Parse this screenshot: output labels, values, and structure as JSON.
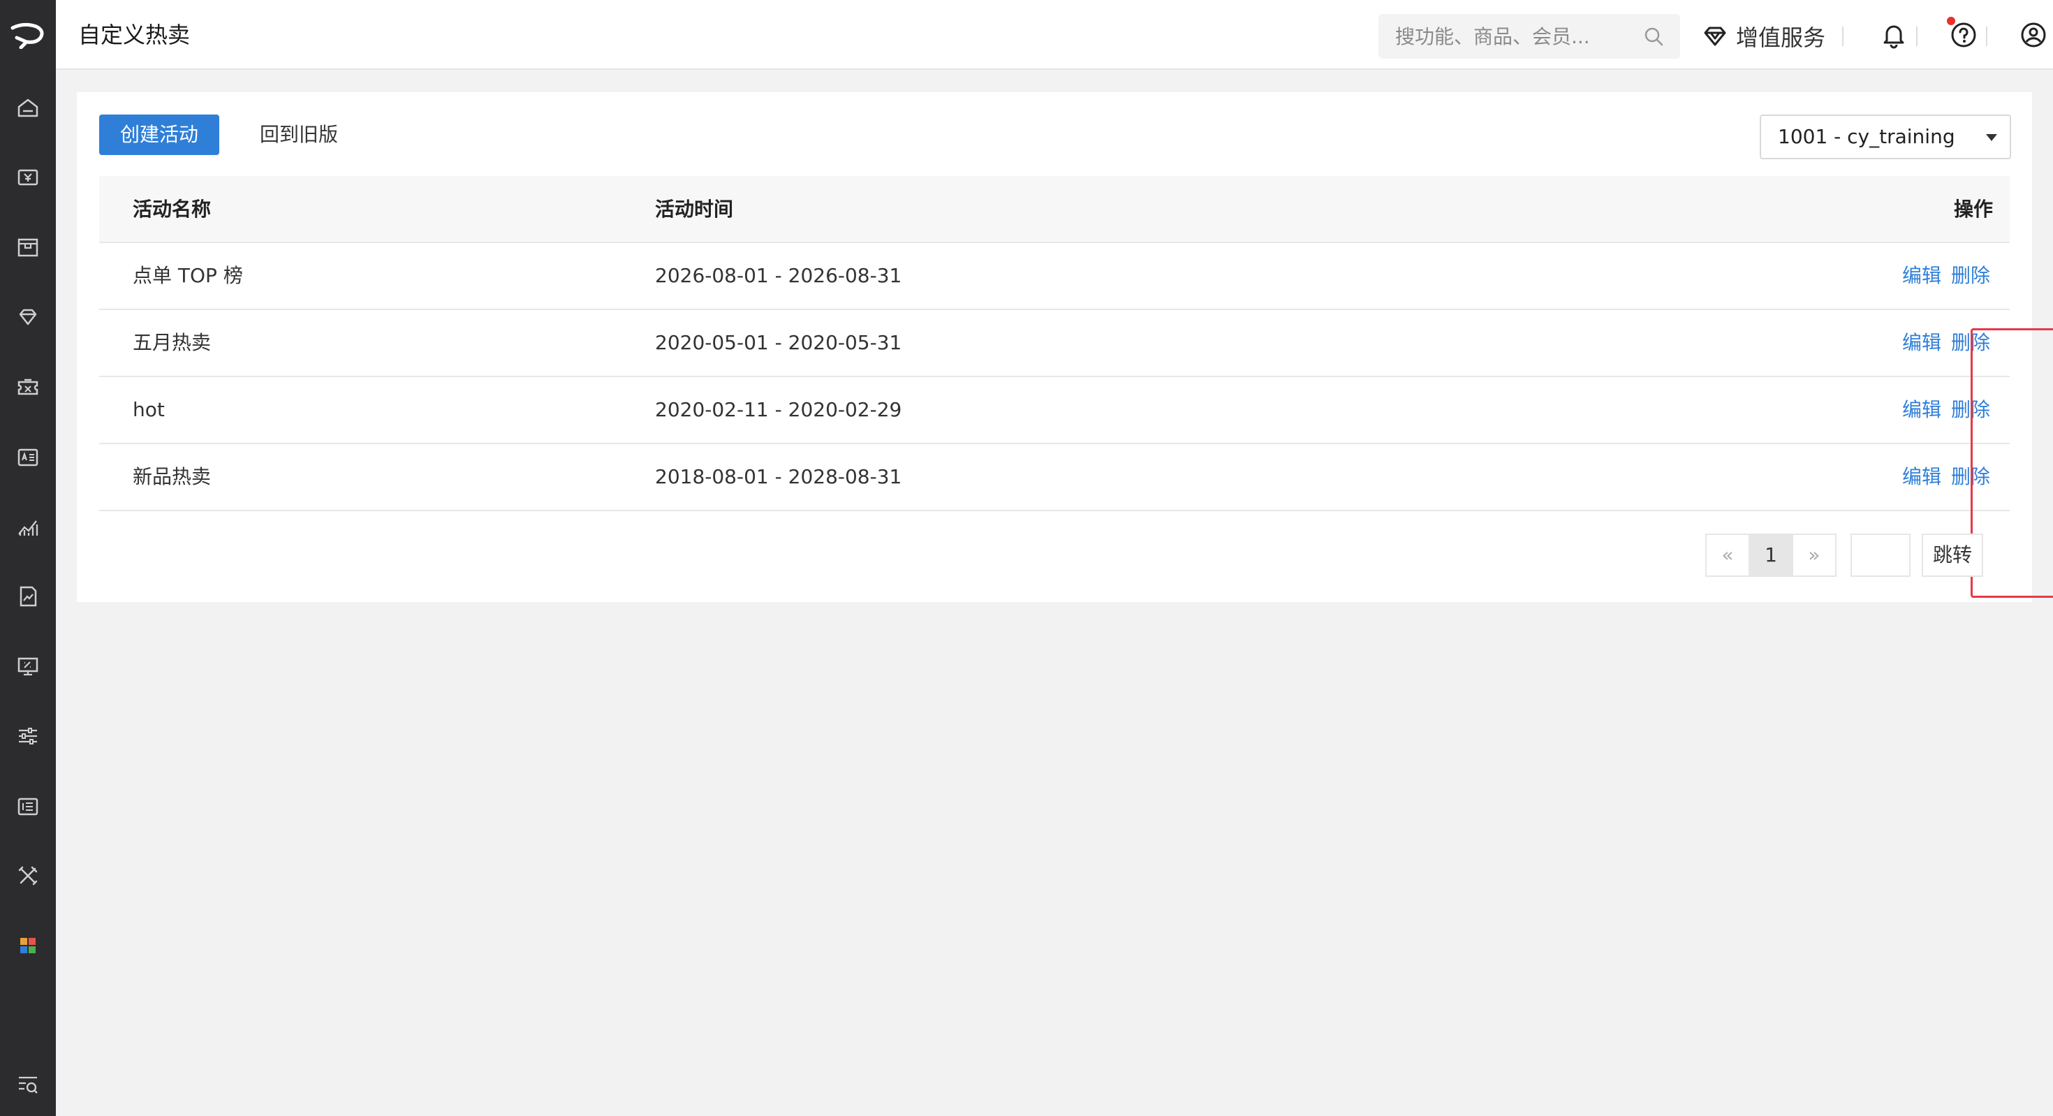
{
  "header": {
    "title": "自定义热卖",
    "search_placeholder": "搜功能、商品、会员...",
    "value_added_label": "增值服务"
  },
  "toolbar": {
    "create_label": "创建活动",
    "old_version_label": "回到旧版",
    "store_value": "1001 - cy_training"
  },
  "table": {
    "columns": [
      "活动名称",
      "活动时间",
      "操作"
    ],
    "rows": [
      {
        "name": "点单 TOP 榜",
        "time": "2026-08-01 - 2026-08-31",
        "edit": "编辑",
        "delete": "删除"
      },
      {
        "name": "五月热卖",
        "time": "2020-05-01 - 2020-05-31",
        "edit": "编辑",
        "delete": "删除"
      },
      {
        "name": "hot",
        "time": "2020-02-11 - 2020-02-29",
        "edit": "编辑",
        "delete": "删除"
      },
      {
        "name": "新品热卖",
        "time": "2018-08-01 - 2028-08-31",
        "edit": "编辑",
        "delete": "删除"
      }
    ]
  },
  "pagination": {
    "prev": "«",
    "current": "1",
    "next": "»",
    "jump_label": "跳转"
  },
  "colors": {
    "accent": "#2f7fd8",
    "sidebar": "#2c2c2e",
    "highlight": "#e63946"
  },
  "sidebar_icons": [
    "home-icon",
    "yen-card-icon",
    "store-icon",
    "diamond-icon",
    "coupon-icon",
    "member-card-icon",
    "chart-icon",
    "report-icon",
    "monitor-icon",
    "sliders-icon",
    "finance-icon",
    "tools-icon",
    "apps-icon",
    "menu-search-icon"
  ]
}
